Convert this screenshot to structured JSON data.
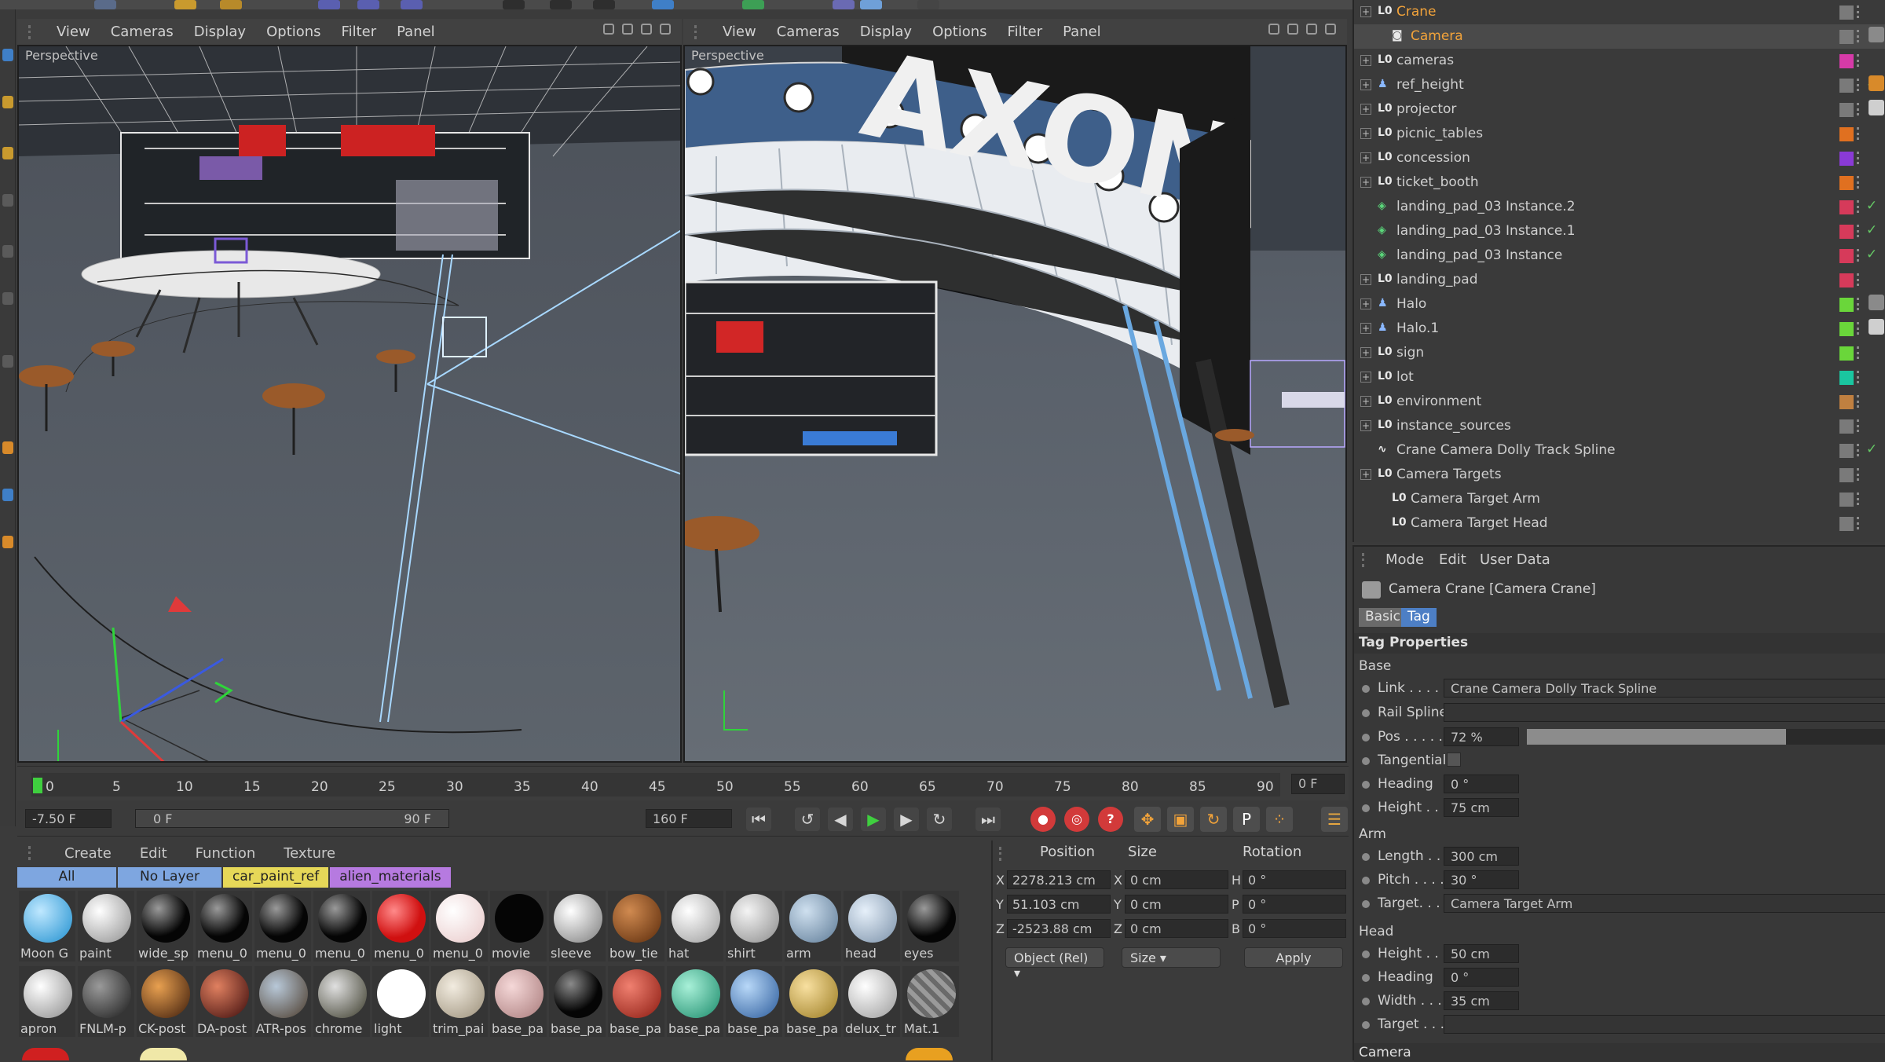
{
  "viewport_left": {
    "menu": [
      "View",
      "Cameras",
      "Display",
      "Options",
      "Filter",
      "Panel"
    ],
    "label": "Perspective"
  },
  "viewport_right": {
    "menu": [
      "View",
      "Cameras",
      "Display",
      "Options",
      "Filter",
      "Panel"
    ],
    "label": "Perspective"
  },
  "timeline": {
    "ticks": [
      "0",
      "5",
      "10",
      "15",
      "20",
      "25",
      "30",
      "35",
      "40",
      "45",
      "50",
      "55",
      "60",
      "65",
      "70",
      "75",
      "80",
      "85",
      "90"
    ],
    "current_frame": "0 F"
  },
  "transport": {
    "start_field": "-7.50 F",
    "range_start": "0 F",
    "range_end": "90 F",
    "end_field": "160 F"
  },
  "material_manager": {
    "menu": [
      "Create",
      "Edit",
      "Function",
      "Texture"
    ],
    "tabs": [
      "All",
      "No Layer",
      "car_paint_ref",
      "alien_materials"
    ],
    "materials_row1": [
      "Moon G",
      "paint",
      "wide_sp",
      "menu_0",
      "menu_0",
      "menu_0",
      "menu_0",
      "menu_0",
      "movie",
      "sleeve",
      "bow_tie",
      "hat",
      "shirt",
      "arm",
      "head",
      "eyes"
    ],
    "materials_row2": [
      "apron",
      "FNLM-p",
      "CK-post",
      "DA-post",
      "ATR-pos",
      "chrome",
      "light",
      "trim_pai",
      "base_pa",
      "base_pa",
      "base_pa",
      "base_pa",
      "base_pa",
      "base_pa",
      "delux_tr",
      "Mat.1"
    ]
  },
  "coordinates": {
    "headers": [
      "Position",
      "Size",
      "Rotation"
    ],
    "axis_pos": [
      "X",
      "Y",
      "Z"
    ],
    "axis_size": [
      "X",
      "Y",
      "Z"
    ],
    "axis_rot": [
      "H",
      "P",
      "B"
    ],
    "pos": [
      "2278.213 cm",
      "51.103 cm",
      "-2523.88 cm"
    ],
    "size": [
      "0 cm",
      "0 cm",
      "0 cm"
    ],
    "rot": [
      "0 °",
      "0 °",
      "0 °"
    ],
    "mode": "Object (Rel)",
    "size_mode": "Size",
    "apply": "Apply"
  },
  "objects": [
    {
      "name": "Crane",
      "icon": "null-icon",
      "color": "#7a7a7a",
      "selected": true
    },
    {
      "name": "Camera",
      "icon": "camera-icon",
      "color": "#7a7a7a",
      "selected": true
    },
    {
      "name": "cameras",
      "icon": "null-icon",
      "color": "#d63aa8"
    },
    {
      "name": "ref_height",
      "icon": "figure-icon",
      "color": "#7a7a7a"
    },
    {
      "name": "projector",
      "icon": "null-icon",
      "color": "#7a7a7a"
    },
    {
      "name": "picnic_tables",
      "icon": "null-icon",
      "color": "#e07020"
    },
    {
      "name": "concession",
      "icon": "null-icon",
      "color": "#8a3ad6"
    },
    {
      "name": "ticket_booth",
      "icon": "null-icon",
      "color": "#e07020"
    },
    {
      "name": "landing_pad_03 Instance.2",
      "icon": "instance-icon",
      "color": "#d63a5a"
    },
    {
      "name": "landing_pad_03 Instance.1",
      "icon": "instance-icon",
      "color": "#d63a5a"
    },
    {
      "name": "landing_pad_03 Instance",
      "icon": "instance-icon",
      "color": "#d63a5a"
    },
    {
      "name": "landing_pad",
      "icon": "null-icon",
      "color": "#d63a5a"
    },
    {
      "name": "Halo",
      "icon": "figure-icon",
      "color": "#6ad63a"
    },
    {
      "name": "Halo.1",
      "icon": "figure-icon",
      "color": "#6ad63a"
    },
    {
      "name": "sign",
      "icon": "null-icon",
      "color": "#6ad63a"
    },
    {
      "name": "lot",
      "icon": "null-icon",
      "color": "#1ac6a0"
    },
    {
      "name": "environment",
      "icon": "null-icon",
      "color": "#c08040"
    },
    {
      "name": "instance_sources",
      "icon": "null-icon",
      "color": "#7a7a7a"
    },
    {
      "name": "Crane Camera Dolly Track Spline",
      "icon": "spline-icon",
      "color": "#7a7a7a"
    },
    {
      "name": "Camera Targets",
      "icon": "null-icon",
      "color": "#7a7a7a"
    },
    {
      "name": "Camera Target Arm",
      "icon": "null-icon",
      "color": "#7a7a7a"
    },
    {
      "name": "Camera Target Head",
      "icon": "null-icon",
      "color": "#7a7a7a"
    }
  ],
  "attributes": {
    "menu": [
      "Mode",
      "Edit",
      "User Data"
    ],
    "title": "Camera Crane [Camera Crane]",
    "tabs": [
      "Basic",
      "Tag"
    ],
    "section": "Tag Properties",
    "base": {
      "heading": "Base",
      "link_label": "Link . . . .",
      "link_value": "Crane Camera Dolly Track Spline",
      "rail_label": "Rail Spline",
      "pos_label": "Pos . . . . .",
      "pos_value": "72 %",
      "pos_fraction": 0.72,
      "tangential_label": "Tangential",
      "heading_label": "Heading",
      "heading_value": "0 °",
      "height_label": "Height . . .",
      "height_value": "75 cm"
    },
    "arm": {
      "heading": "Arm",
      "length_label": "Length . . .",
      "length_value": "300 cm",
      "pitch_label": "Pitch . . . .",
      "pitch_value": "30 °",
      "target_label": "Target. . . .",
      "target_value": "Camera Target Arm"
    },
    "head": {
      "heading": "Head",
      "height_label": "Height . . .",
      "height_value": "50 cm",
      "heading_label": "Heading",
      "heading_value": "0 °",
      "width_label": "Width . . . .",
      "width_value": "35 cm",
      "target_label": "Target . . . ."
    },
    "camera_heading": "Camera"
  }
}
